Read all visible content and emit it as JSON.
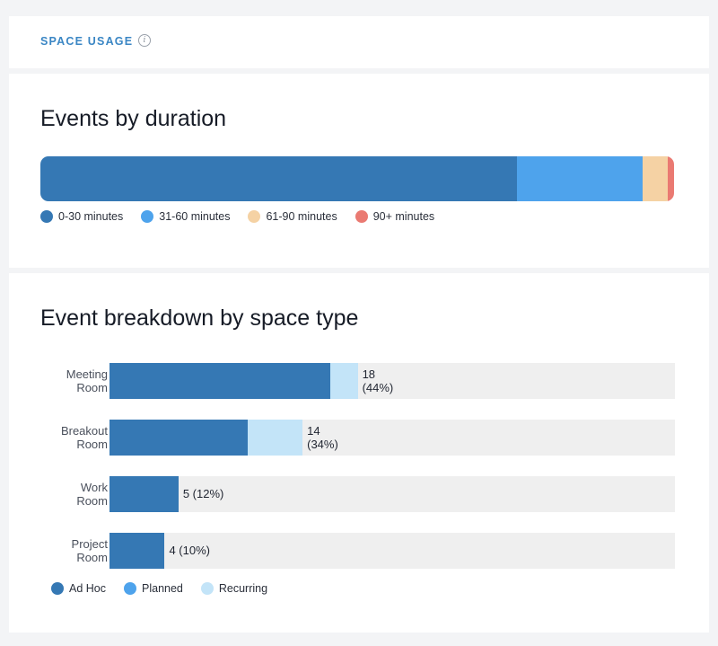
{
  "header": {
    "section_label": "SPACE USAGE",
    "info_icon": "info-icon"
  },
  "chart_data": [
    {
      "type": "bar",
      "stacked": true,
      "orientation": "horizontal",
      "title": "Events by duration",
      "categories": [
        "0-30 minutes",
        "31-60 minutes",
        "61-90 minutes",
        "90+ minutes"
      ],
      "values": [
        75.3,
        19.8,
        4.0,
        1.0
      ],
      "unit": "percent of events",
      "colors": [
        "#3578b4",
        "#4ea3ec",
        "#f5d2a4",
        "#ea7a72"
      ],
      "legend": "bottom-left"
    },
    {
      "type": "bar",
      "stacked": true,
      "orientation": "horizontal",
      "title": "Event breakdown by space type",
      "categories": [
        {
          "line1": "Meeting",
          "line2": "Room"
        },
        {
          "line1": "Breakout",
          "line2": "Room"
        },
        {
          "line1": "Work",
          "line2": "Room"
        },
        {
          "line1": "Project",
          "line2": "Room"
        }
      ],
      "series": [
        {
          "name": "Ad Hoc",
          "color": "#3578b4",
          "values": [
            16,
            10,
            5,
            4
          ]
        },
        {
          "name": "Planned",
          "color": "#4ea3ec",
          "values": [
            0,
            0,
            0,
            0
          ]
        },
        {
          "name": "Recurring",
          "color": "#c3e4f8",
          "values": [
            2,
            4,
            0,
            0
          ]
        }
      ],
      "totals": [
        18,
        14,
        5,
        4
      ],
      "value_labels": [
        {
          "line1": "18",
          "line2": "(44%)"
        },
        {
          "line1": "14",
          "line2": "(34%)"
        },
        {
          "line1": "5 (12%)",
          "line2": ""
        },
        {
          "line1": "4 (10%)",
          "line2": ""
        }
      ],
      "xlim": [
        0,
        41
      ],
      "legend": "bottom-left"
    }
  ]
}
